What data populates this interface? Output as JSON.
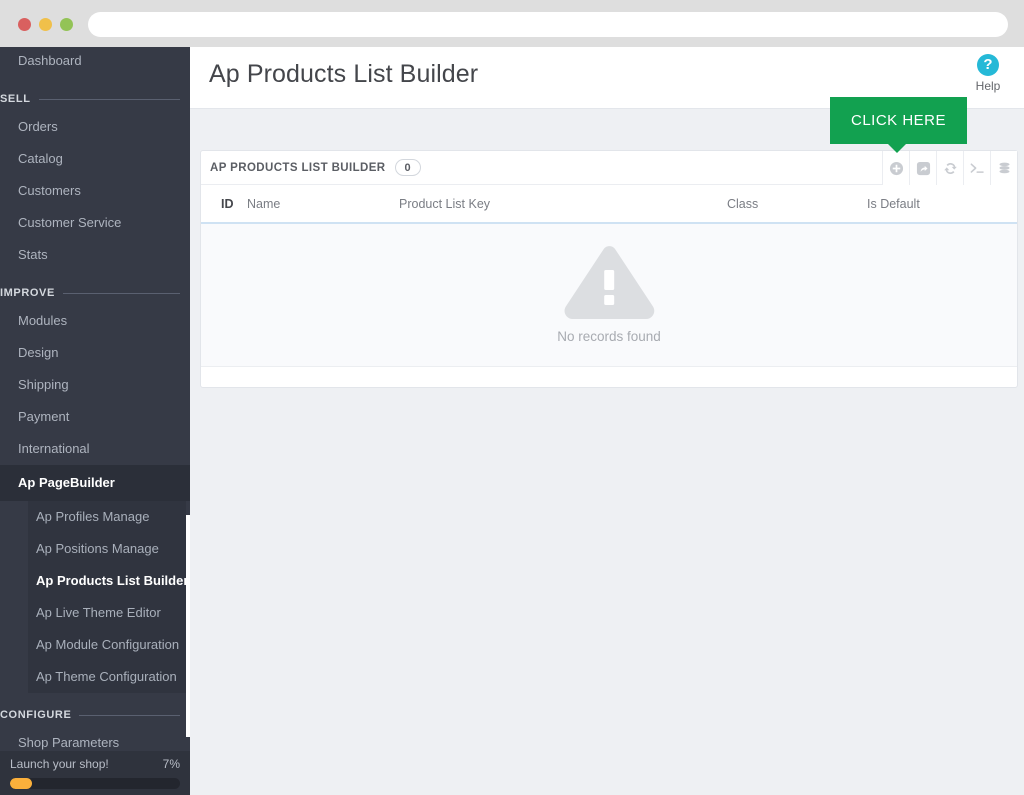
{
  "browser": {
    "url_value": "",
    "url_placeholder": "",
    "traffic_lights": [
      "close-red",
      "minimize-yellow",
      "maximize-green"
    ]
  },
  "sidebar": {
    "top_item": {
      "label": "Dashboard"
    },
    "sections": [
      {
        "label": "SELL",
        "items": [
          {
            "label": "Orders"
          },
          {
            "label": "Catalog"
          },
          {
            "label": "Customers"
          },
          {
            "label": "Customer Service"
          },
          {
            "label": "Stats"
          }
        ]
      },
      {
        "label": "IMPROVE",
        "items": [
          {
            "label": "Modules"
          },
          {
            "label": "Design"
          },
          {
            "label": "Shipping"
          },
          {
            "label": "Payment"
          },
          {
            "label": "International"
          }
        ]
      }
    ],
    "active_parent": {
      "label": "Ap PageBuilder"
    },
    "submenu": [
      {
        "label": "Ap Profiles Manage",
        "active": false
      },
      {
        "label": "Ap Positions Manage",
        "active": false
      },
      {
        "label": "Ap Products List Builder",
        "active": true
      },
      {
        "label": "Ap Live Theme Editor",
        "active": false
      },
      {
        "label": "Ap Module Configuration",
        "active": false
      },
      {
        "label": "Ap Theme Configuration",
        "active": false
      }
    ],
    "configure_section": {
      "label": "CONFIGURE",
      "items": [
        {
          "label": "Shop Parameters"
        }
      ]
    },
    "launch_shop": {
      "label": "Launch your shop!",
      "percent_label": "7%",
      "percent_value": 7,
      "bar_color": "#fbb03b"
    }
  },
  "header": {
    "title": "Ap Products List Builder",
    "help_icon": "question-mark-icon",
    "help_label": "Help",
    "help_color": "#25b9d7"
  },
  "callout": {
    "text": "CLICK HERE",
    "color": "#12a150"
  },
  "panel": {
    "title": "AP PRODUCTS LIST BUILDER",
    "count": "0",
    "tools": [
      {
        "name": "add-new-icon",
        "title": "Add new"
      },
      {
        "name": "export-icon",
        "title": "Export"
      },
      {
        "name": "refresh-icon",
        "title": "Refresh list"
      },
      {
        "name": "terminal-icon",
        "title": "Show SQL query"
      },
      {
        "name": "database-icon",
        "title": "Export to SQL manager"
      }
    ],
    "columns": [
      {
        "key": "id",
        "label": "ID"
      },
      {
        "key": "name",
        "label": "Name"
      },
      {
        "key": "product_list_key",
        "label": "Product List Key"
      },
      {
        "key": "class",
        "label": "Class"
      },
      {
        "key": "is_default",
        "label": "Is Default"
      }
    ],
    "rows": [],
    "empty_state": {
      "icon": "warning-triangle-icon",
      "text": "No records found"
    }
  }
}
